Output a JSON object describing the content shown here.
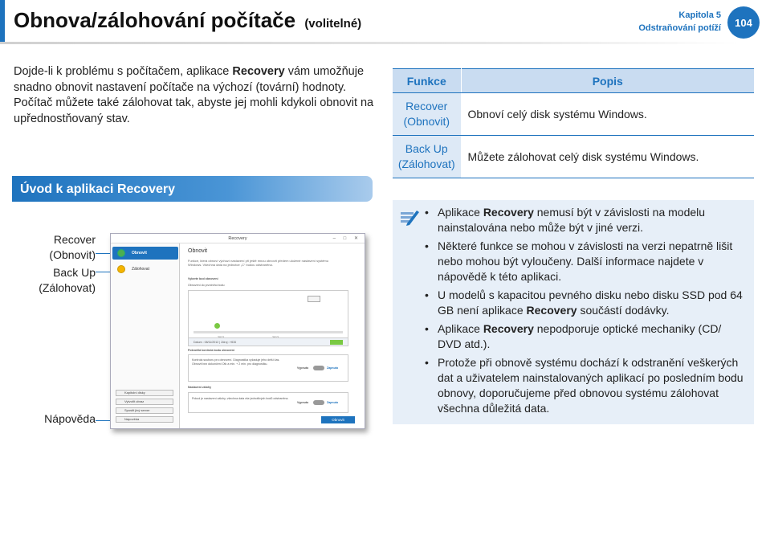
{
  "header": {
    "title": "Obnova/zálohování počítače",
    "title_suffix": "(volitelné)",
    "chapter": "Kapitola 5",
    "chapter_title": "Odstraňování potíží",
    "page_number": "104"
  },
  "intro": {
    "text_before": "Dojde-li k problému s počítačem, aplikace ",
    "bold": "Recovery",
    "text_after": " vám umožňuje snadno obnovit nastavení počítače na výchozí (tovární) hodnoty. Počítač můžete také zálohovat tak, abyste jej mohli kdykoli obnovit na upřednostňovaný stav."
  },
  "section": {
    "title": "Úvod k aplikaci Recovery"
  },
  "callouts": {
    "recover": "Recover\n(Obnovit)",
    "backup": "Back Up\n(Zálohovat)",
    "help": "Nápověda"
  },
  "screenshot": {
    "window_title": "Recovery",
    "window_controls": "– □ ✕",
    "side_recover": "Obnovit",
    "side_backup": "Zálohovat",
    "side_btn_1": "Kapitolní disky",
    "side_btn_2": "Vytvořit obraz",
    "side_btn_3": "Spustit jiný server",
    "side_btn_4": "Nápověda",
    "main_heading": "Obnovit",
    "main_desc": "Funkce, která obnoví výchozí nastavení při ještě mnou obnovit předem uložené nastavení systému Windows. Všechna data na jednotce „C“ budou odstraněna.",
    "panel_head": "Vyberte bod obnovení",
    "panel_sub": "Obnovení do prvotního bodu",
    "year_1": "2012",
    "year_2": "2013",
    "meta": "Datum : 08/11/2012  |  Zdroj : HDD",
    "opt1_head": "Pokročilá kontrola bodu obnovení",
    "opt1_text": "Kontrola souboru pro obnovení. Diagnostika vyžaduje jeho delší čas. Obnovit bez dokončení Otk a min. + 2 min. pro diagnostiku.",
    "opt2_head": "Nastavení zálohy",
    "opt2_text": "Pokud je nastavení zálohy, všechna data vše jednotlivých bodů odstraněna.",
    "toggle_off": "Vypnuto",
    "toggle_on": "Zapnuto",
    "ok_button": "Obnovit"
  },
  "table": {
    "headers": [
      "Funkce",
      "Popis"
    ],
    "rows": [
      {
        "fn": "Recover\n(Obnovit)",
        "desc": "Obnoví celý disk systému Windows."
      },
      {
        "fn": "Back Up\n(Zálohovat)",
        "desc": "Můžete zálohovat celý disk systému Windows."
      }
    ]
  },
  "notes": {
    "n1_a": "Aplikace ",
    "n1_b": "Recovery",
    "n1_c": " nemusí být v závislosti na modelu nainstalována nebo může být v jiné verzi.",
    "n2": "Některé funkce se mohou v závislosti na verzi nepatrně lišit nebo mohou být vyloučeny. Další informace najdete v nápovědě k této aplikaci.",
    "n3_a": "U modelů s kapacitou pevného disku nebo disku SSD pod 64 GB není aplikace ",
    "n3_b": "Recovery",
    "n3_c": " součástí dodávky.",
    "n4_a": "Aplikace ",
    "n4_b": "Recovery",
    "n4_c": " nepodporuje optické mechaniky (CD/ DVD atd.).",
    "n5": "Protože při obnově systému dochází k odstranění veškerých dat a uživatelem nainstalovaných aplikací po posledním bodu obnovy, doporučujeme před obnovou systému zálohovat všechna důležitá data."
  },
  "colors": {
    "accent": "#1e73be",
    "table_head": "#c9dcf1",
    "note_bg": "#e7eff8"
  }
}
